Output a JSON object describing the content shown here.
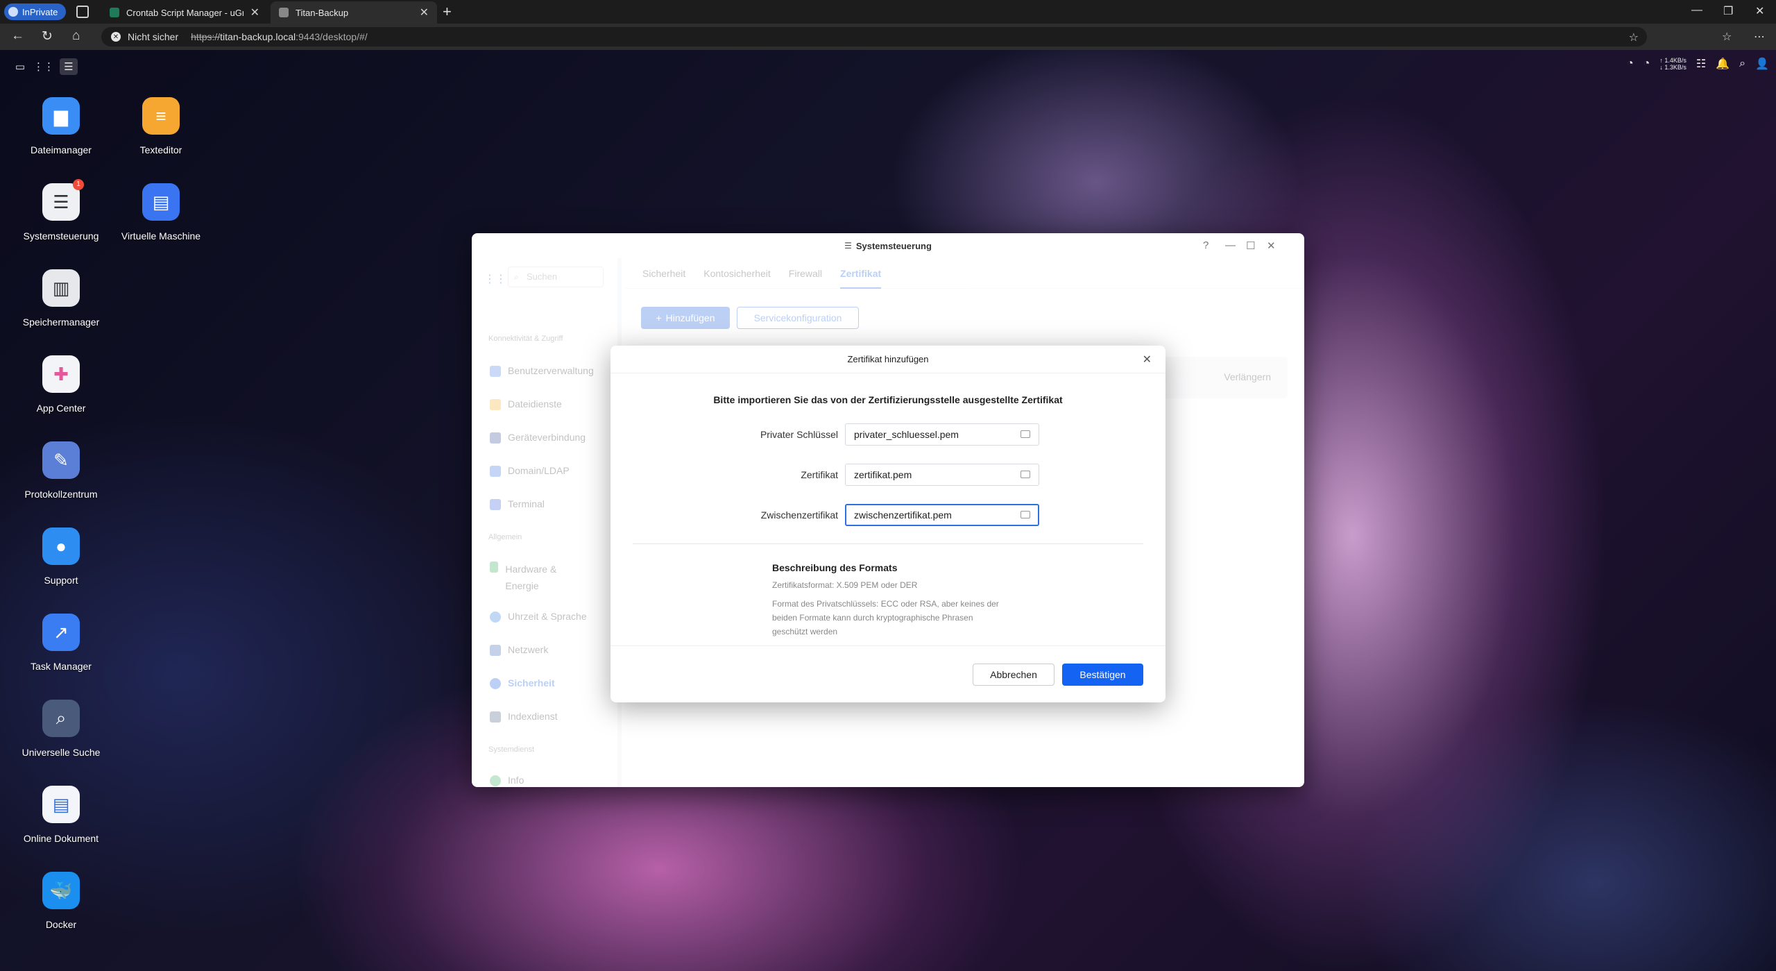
{
  "browser": {
    "inprivate_label": "InPrivate",
    "tabs": [
      {
        "title": "Crontab Script Manager - uGreen"
      },
      {
        "title": "Titan-Backup"
      }
    ],
    "address": {
      "security_label": "Nicht sicher",
      "url_scheme": "https://",
      "url_host": "titan-backup.local",
      "url_rest": ":9443/desktop/#/"
    }
  },
  "desktop": {
    "netspeed": {
      "up": "↑ 1.4KB/s",
      "down": "↓ 1.3KB/s"
    },
    "icons": [
      {
        "label": "Dateimanager",
        "color": "#3a8df5"
      },
      {
        "label": "Texteditor",
        "color": "#f6a732"
      },
      {
        "label": "Systemsteuerung",
        "color": "#eef0f3",
        "badge": "1"
      },
      {
        "label": "Virtuelle Maschine",
        "color": "#3a74f0"
      },
      {
        "label": "Speichermanager",
        "color": "#e6e8ec"
      },
      {
        "label": "App Center",
        "color": "#f3f4f8"
      },
      {
        "label": "Protokollzentrum",
        "color": "#5b7fd6"
      },
      {
        "label": "Support",
        "color": "#2e8df0"
      },
      {
        "label": "Task Manager",
        "color": "#3a7df2"
      },
      {
        "label": "Universelle Suche",
        "color": "#4a5a7a"
      },
      {
        "label": "Online Dokument",
        "color": "#f3f5fb"
      },
      {
        "label": "Docker",
        "color": "#1b8ff0"
      }
    ]
  },
  "control_panel": {
    "title": "Systemsteuerung",
    "search_placeholder": "Suchen",
    "sections": {
      "connectivity": "Konnektivität & Zugriff",
      "general": "Allgemein",
      "system": "Systemdienst"
    },
    "nav": [
      {
        "label": "Benutzerverwaltung",
        "color": "#5a8ae8"
      },
      {
        "label": "Dateidienste",
        "color": "#f3b53f"
      },
      {
        "label": "Geräteverbindung",
        "color": "#4b5fa0"
      },
      {
        "label": "Domain/LDAP",
        "color": "#4d7fe4"
      },
      {
        "label": "Terminal",
        "color": "#4c6fe0"
      },
      {
        "label": "Hardware & Energie",
        "color": "#46b46a"
      },
      {
        "label": "Uhrzeit & Sprache",
        "color": "#3f87e6"
      },
      {
        "label": "Netzwerk",
        "color": "#4b73c4"
      },
      {
        "label": "Sicherheit",
        "color": "#2f6fe0"
      },
      {
        "label": "Indexdienst",
        "color": "#5a6d8e"
      },
      {
        "label": "Info",
        "color": "#49b56a"
      }
    ],
    "tabs": [
      "Sicherheit",
      "Kontosicherheit",
      "Firewall",
      "Zertifikat"
    ],
    "active_tab": "Zertifikat",
    "add_button": "Hinzufügen",
    "service_config_button": "Servicekonfiguration",
    "renew_label": "Verlängern"
  },
  "dialog": {
    "title": "Zertifikat hinzufügen",
    "intro": "Bitte importieren Sie das von der Zertifizierungsstelle ausgestellte Zertifikat",
    "fields": [
      {
        "label": "Privater Schlüssel",
        "value": "privater_schluessel.pem"
      },
      {
        "label": "Zertifikat",
        "value": "zertifikat.pem"
      },
      {
        "label": "Zwischenzertifikat",
        "value": "zwischenzertifikat.pem"
      }
    ],
    "format_title": "Beschreibung des Formats",
    "format_cert": "Zertifikatsformat: X.509 PEM oder DER",
    "format_key": "Format des Privatschlüssels: ECC oder RSA, aber keines der beiden Formate kann durch kryptographische Phrasen geschützt werden",
    "cancel": "Abbrechen",
    "confirm": "Bestätigen"
  }
}
